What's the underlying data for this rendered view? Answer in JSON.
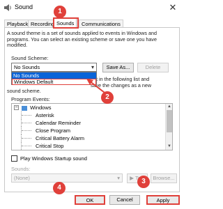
{
  "window": {
    "title": "Sound",
    "close_glyph": "✕"
  },
  "tabs": [
    {
      "label": "Playback",
      "active": false
    },
    {
      "label": "Recording",
      "active": false
    },
    {
      "label": "Sounds",
      "active": true
    },
    {
      "label": "Communications",
      "active": false
    }
  ],
  "description": "A sound theme is a set of sounds applied to events in Windows and programs. You can select an existing scheme or save one you have modified.",
  "scheme": {
    "label": "Sound Scheme:",
    "selected": "No Sounds",
    "options": [
      "No Sounds",
      "Windows Default"
    ],
    "save_as_label": "Save As...",
    "delete_label": "Delete"
  },
  "hint_text": {
    "line1": "ent in the following list and",
    "line2": "save the changes as a new",
    "line3": "sound scheme."
  },
  "events": {
    "label": "Program Events:",
    "group": "Windows",
    "items": [
      "Asterisk",
      "Calendar Reminder",
      "Close Program",
      "Critical Battery Alarm",
      "Critical Stop"
    ]
  },
  "startup": {
    "label": "Play Windows Startup sound",
    "checked": false
  },
  "sounds": {
    "label": "Sounds:",
    "value": "(None)",
    "test_label": "Test",
    "browse_label": "Browse..."
  },
  "footer": {
    "ok_label": "OK",
    "cancel_label": "Cancel",
    "apply_label": "Apply"
  },
  "markers": [
    "1",
    "2",
    "3",
    "4"
  ],
  "accent_color": "#e0403a"
}
